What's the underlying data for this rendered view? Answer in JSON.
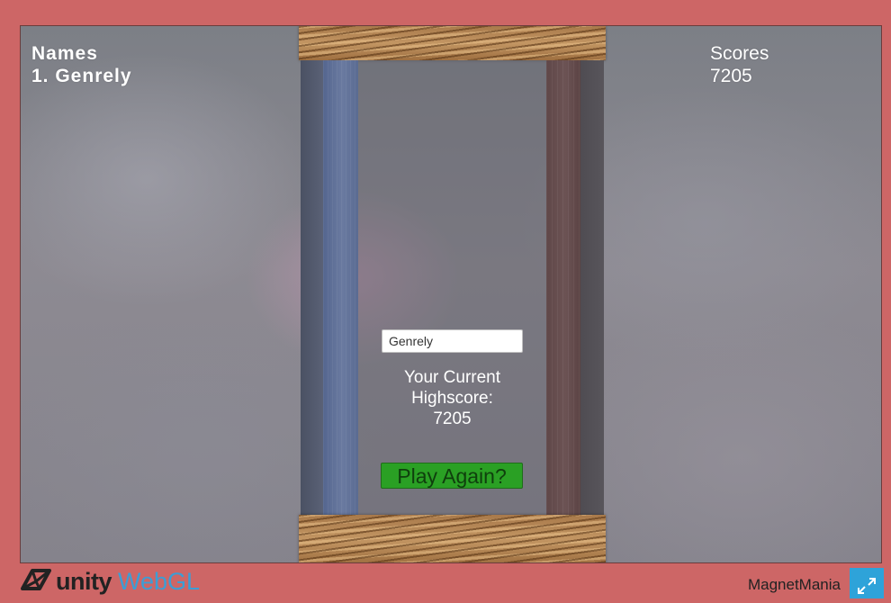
{
  "leaderboard": {
    "names_header": "Names",
    "names": [
      "1. Genrely"
    ],
    "scores_header": "Scores",
    "scores": [
      "7205"
    ]
  },
  "player": {
    "name_value": "Genrely",
    "highscore_line1": "Your Current",
    "highscore_line2": "Highscore:",
    "highscore_value": "7205"
  },
  "actions": {
    "play_again_label": "Play Again?"
  },
  "footer": {
    "engine_name": "unity",
    "platform_name": "WebGL",
    "game_title": "MagnetMania",
    "fullscreen_icon": "fullscreen-icon"
  },
  "colors": {
    "page_background": "#cd6666",
    "play_button": "#2aa024",
    "fullscreen_button": "#2ea3d9",
    "webgl_text": "#3b9ed6"
  }
}
